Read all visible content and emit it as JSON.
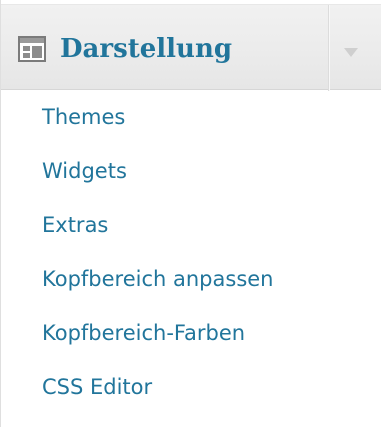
{
  "menu": {
    "title": "Darstellung",
    "icon": "appearance-icon",
    "toggle_icon": "triangle-down-icon",
    "accent_color": "#21759b",
    "items": [
      {
        "label": "Themes"
      },
      {
        "label": "Widgets"
      },
      {
        "label": "Extras"
      },
      {
        "label": "Kopfbereich anpassen"
      },
      {
        "label": "Kopfbereich-Farben"
      },
      {
        "label": "CSS Editor"
      }
    ]
  }
}
